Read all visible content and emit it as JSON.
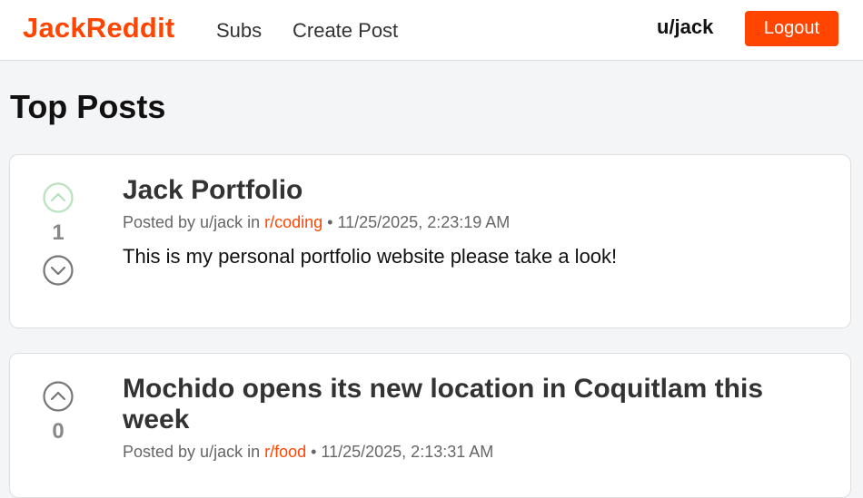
{
  "navbar": {
    "brand": "JackReddit",
    "links": [
      "Subs",
      "Create Post"
    ],
    "username": "u/jack",
    "logout_label": "Logout",
    "accent_color": "#ff4500"
  },
  "page": {
    "title": "Top Posts"
  },
  "posts": [
    {
      "title": "Jack Portfolio",
      "meta_prefix": "Posted by u/jack in ",
      "subreddit": "r/coding",
      "meta_suffix": " • 11/25/2025, 2:23:19 AM",
      "content": "This is my personal portfolio website please take a look!",
      "score": "1",
      "upvote_icon": "chevron-up-circle-icon",
      "upvote_color": "#b6e3bd",
      "downvote_icon": "chevron-down-circle-icon",
      "downvote_color": "#777777"
    },
    {
      "title": "Mochido opens its new location in Coquitlam this week",
      "meta_prefix": "Posted by u/jack in ",
      "subreddit": "r/food",
      "meta_suffix": " • 11/25/2025, 2:13:31 AM",
      "score": "0",
      "upvote_icon": "chevron-up-circle-icon",
      "upvote_color": "#777777"
    }
  ]
}
